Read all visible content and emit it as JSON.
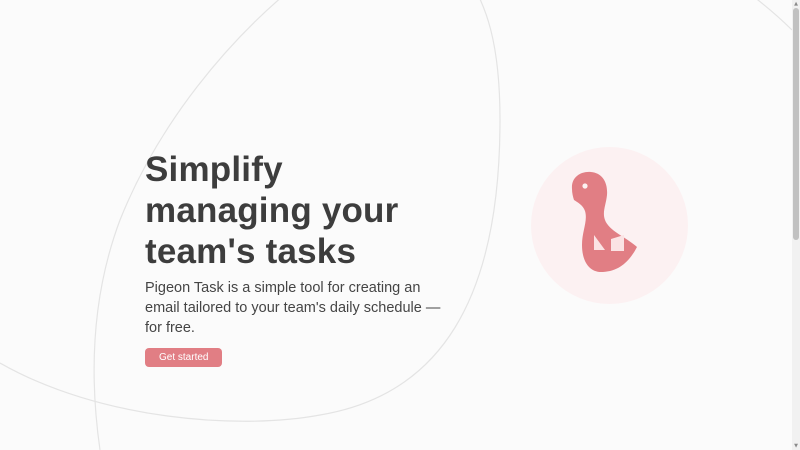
{
  "hero": {
    "title": "Simplify managing your team's tasks",
    "subtitle": "Pigeon Task is a simple tool for creating an email tailored to your team's daily schedule — for free.",
    "cta_label": "Get started"
  },
  "icons": {
    "logo": "pigeon-logo-icon",
    "scroll_up": "scroll-up-arrow-icon",
    "scroll_down": "scroll-down-arrow-icon"
  },
  "colors": {
    "brand": "#e17e84",
    "logo_circle": "#fcf1f2",
    "text": "#3d3d3d",
    "background": "#fbfbfb"
  },
  "scrollbar": {
    "up_glyph": "▲",
    "down_glyph": "▼"
  }
}
